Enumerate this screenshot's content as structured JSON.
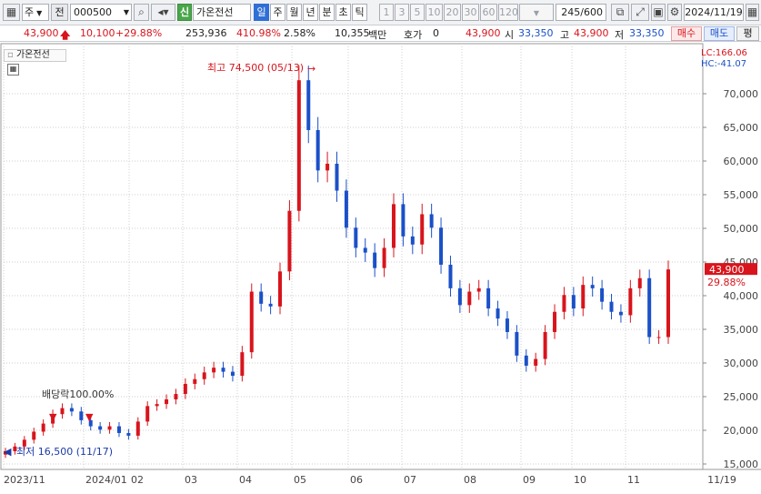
{
  "toolbar": {
    "market": "주",
    "period_mode": "전",
    "code": "000500",
    "stock_badge": "신",
    "stock_name": "가온전선",
    "intervals": [
      "일",
      "주",
      "월",
      "년",
      "분",
      "초",
      "틱"
    ],
    "selected_interval": "일",
    "minute_presets": [
      "1",
      "3",
      "5",
      "10",
      "20",
      "30",
      "60",
      "120"
    ],
    "count": "245",
    "count_max": "/600",
    "date": "2024/11/19"
  },
  "quote": {
    "price": "43,900",
    "change": "10,100",
    "change_pct": "+29.88%",
    "volume": "253,936",
    "volume_ratio": "410.98%",
    "turnover_pct": "2.58%",
    "amount": "10,355",
    "amount_unit": "백만",
    "hoga_label": "호가",
    "hoga_value": "0",
    "ask": "43,900",
    "open_label": "시",
    "open": "33,350",
    "high_label": "고",
    "high": "43,900",
    "low_label": "저",
    "low": "33,350",
    "buy_label": "매수",
    "sell_label": "매도",
    "eval_label": "평"
  },
  "chart_data": {
    "type": "line",
    "title": "가온전선",
    "x_tick_labels": [
      "2023/11",
      "2024/01",
      "02",
      "03",
      "04",
      "05",
      "06",
      "07",
      "08",
      "09",
      "10",
      "11",
      "11/19"
    ],
    "ylim": [
      14000,
      74000
    ],
    "y_ticks": [
      15000,
      20000,
      25000,
      30000,
      35000,
      40000,
      45000,
      50000,
      55000,
      60000,
      65000,
      70000
    ],
    "y_tick_labels": [
      "15,000",
      "20,000",
      "25,000",
      "30,000",
      "35,000",
      "40,000",
      "45,000",
      "50,000",
      "55,000",
      "60,000",
      "65,000",
      "70,000"
    ],
    "series": [
      {
        "values": [
          16900,
          17600,
          18600,
          19800,
          21000,
          22400,
          23300,
          22800,
          21500,
          20600,
          20100,
          20600,
          19600,
          19200,
          21300,
          23600,
          23900,
          24600,
          25400,
          26900,
          27600,
          28600,
          29300,
          28700,
          28100,
          31600,
          40600,
          38800,
          38400,
          43600,
          52600,
          72000,
          64600,
          58600,
          59600,
          55600,
          50100,
          47100,
          46400,
          44100,
          47100,
          53600,
          48800,
          47600,
          52100,
          50100,
          44600,
          41100,
          38600,
          40600,
          41100,
          38100,
          36600,
          34600,
          31100,
          29600,
          30600,
          34600,
          37600,
          40100,
          38100,
          41600,
          41100,
          39100,
          37600,
          37100,
          41100,
          42600,
          33850,
          33850,
          43900
        ]
      }
    ],
    "price_label": "43,900",
    "change_label": "29.88%",
    "lc": "LC:166.06",
    "hc": "HC:-41.07",
    "high_annotation": "최고 74,500 (05/13)",
    "low_annotation": "최저 16,500 (11/17)",
    "dividend_annotation": "배당락100.00%"
  },
  "colors": {
    "up": "#d8141c",
    "down": "#1a50c8",
    "grid": "#cfcfcf"
  }
}
